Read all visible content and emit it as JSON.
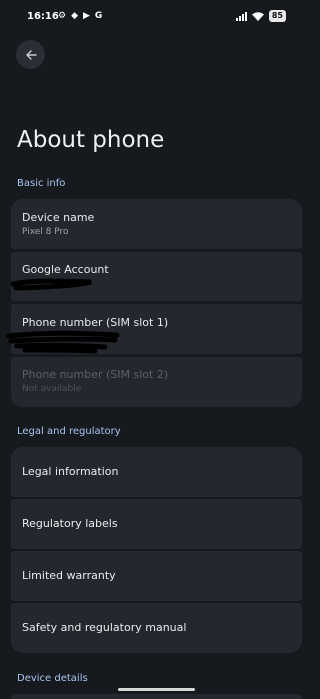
{
  "status": {
    "time": "16:16",
    "battery": "85"
  },
  "page": {
    "title": "About phone"
  },
  "sections": {
    "basic_info": "Basic info",
    "legal": "Legal and regulatory",
    "device_details": "Device details"
  },
  "basic": {
    "device_name": {
      "title": "Device name",
      "sub": "Pixel 8 Pro"
    },
    "google_account": {
      "title": "Google Account"
    },
    "phone_sim1": {
      "title": "Phone number (SIM slot 1)"
    },
    "phone_sim2": {
      "title": "Phone number (SIM slot 2)",
      "sub": "Not available"
    }
  },
  "legal_items": {
    "legal_information": "Legal information",
    "regulatory_labels": "Regulatory labels",
    "limited_warranty": "Limited warranty",
    "safety_manual": "Safety and regulatory manual"
  },
  "colors": {
    "background": "#16191d",
    "card": "#24282e",
    "accent": "#a9c6f1"
  }
}
